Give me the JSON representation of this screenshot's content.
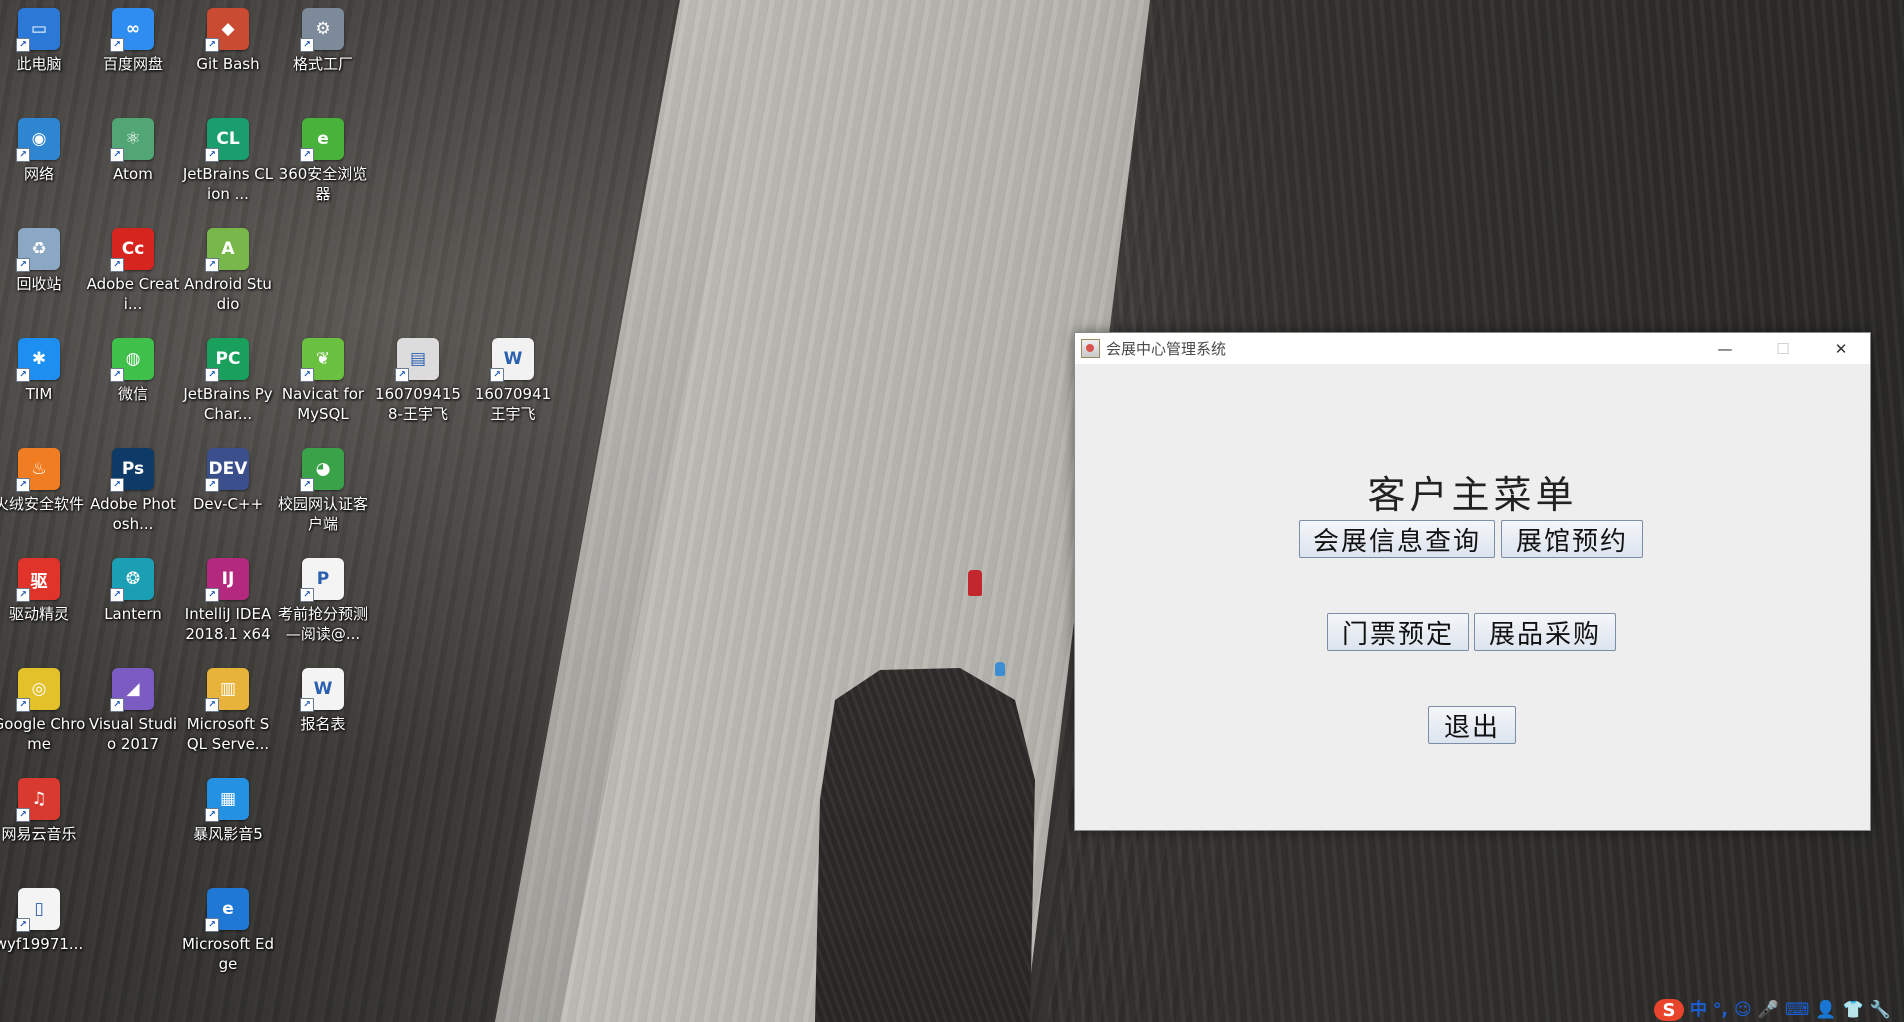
{
  "desktop": {
    "icons": [
      {
        "label": "此电脑",
        "color": "#2b79d6",
        "glyph": "▭"
      },
      {
        "label": "百度网盘",
        "color": "#2f8cf0",
        "glyph": "∞"
      },
      {
        "label": "Git Bash",
        "color": "#c84b32",
        "glyph": "◆"
      },
      {
        "label": "格式工厂",
        "color": "#7d8a99",
        "glyph": "⚙"
      },
      {
        "label": "网络",
        "color": "#2f86d0",
        "glyph": "◉"
      },
      {
        "label": "Atom",
        "color": "#52a675",
        "glyph": "⚛"
      },
      {
        "label": "JetBrains CLion ...",
        "color": "#1b9e6e",
        "glyph": "CL"
      },
      {
        "label": "360安全浏览器",
        "color": "#49b23a",
        "glyph": "e"
      },
      {
        "label": "回收站",
        "color": "#8aa7c4",
        "glyph": "♻"
      },
      {
        "label": "Adobe Creati...",
        "color": "#d6251f",
        "glyph": "Cc"
      },
      {
        "label": "Android Studio",
        "color": "#78b74a",
        "glyph": "A"
      },
      {
        "label": "TIM",
        "color": "#1d8ff0",
        "glyph": "✱"
      },
      {
        "label": "微信",
        "color": "#3ec04a",
        "glyph": "◍"
      },
      {
        "label": "JetBrains PyChar...",
        "color": "#18a05c",
        "glyph": "PC"
      },
      {
        "label": "Navicat for MySQL",
        "color": "#6ac140",
        "glyph": "❦"
      },
      {
        "label": "1607094158-王宇飞",
        "color": "#dcdcdc",
        "glyph": "▤"
      },
      {
        "label": "16070941 王宇飞",
        "color": "#f2f2f2",
        "glyph": "W"
      },
      {
        "label": "火绒安全软件",
        "color": "#f07d22",
        "glyph": "♨"
      },
      {
        "label": "Adobe Photosh...",
        "color": "#0d3a66",
        "glyph": "Ps"
      },
      {
        "label": "Dev-C++",
        "color": "#3a4f8c",
        "glyph": "DEV"
      },
      {
        "label": "校园网认证客户端",
        "color": "#3aa34a",
        "glyph": "◕"
      },
      {
        "label": "驱动精灵",
        "color": "#e0332a",
        "glyph": "驱"
      },
      {
        "label": "Lantern",
        "color": "#1b9fb5",
        "glyph": "❂"
      },
      {
        "label": "IntelliJ IDEA 2018.1 x64",
        "color": "#b2297d",
        "glyph": "IJ"
      },
      {
        "label": "考前抢分预测—阅读@...",
        "color": "#f4f4f4",
        "glyph": "P"
      },
      {
        "label": "Google Chrome",
        "color": "#e2c12a",
        "glyph": "◎"
      },
      {
        "label": "Microsoft SQL Serve...",
        "color": "#e7b33a",
        "glyph": "▥"
      },
      {
        "label": "报名表",
        "color": "#f4f4f4",
        "glyph": "W"
      },
      {
        "label": "网易云音乐",
        "color": "#d93a30",
        "glyph": "♫"
      },
      {
        "label": "Visual Studio 2017",
        "color": "#7b5cc2",
        "glyph": "◢"
      },
      {
        "label": "暴风影音5",
        "color": "#2591e2",
        "glyph": "▦"
      },
      {
        "label": "wyf19971...",
        "color": "#f4f4f4",
        "glyph": "▯"
      },
      {
        "label": "Microsoft Edge",
        "color": "#1f78d3",
        "glyph": "e"
      }
    ]
  },
  "window": {
    "title": "会展中心管理系统",
    "minimize_glyph": "—",
    "maximize_glyph": "☐",
    "close_glyph": "✕",
    "heading": "客户主菜单",
    "buttons": {
      "exhibition_info": "会展信息查询",
      "hall_booking": "展馆预约",
      "ticket_booking": "门票预定",
      "exhibit_purchase": "展品采购",
      "exit": "退出"
    }
  },
  "tray": {
    "ime_logo": "S",
    "ime_mode": "中",
    "punct": "°,",
    "emoji": "☺",
    "mic": "🎤",
    "keyboard": "⌨",
    "user": "👤",
    "shirt": "👕",
    "tool": "🔧"
  }
}
